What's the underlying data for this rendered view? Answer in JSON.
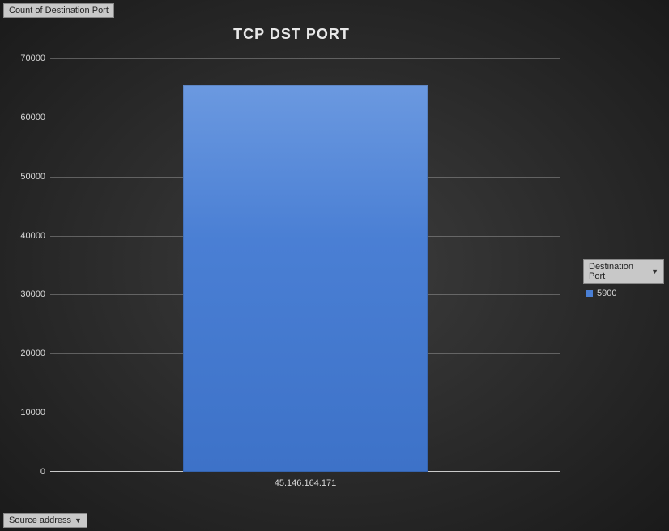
{
  "chart_data": {
    "type": "bar",
    "title": "TCP DST PORT",
    "categories": [
      "45.146.164.171"
    ],
    "series": [
      {
        "name": "5900",
        "values": [
          65500
        ]
      }
    ],
    "ylim": [
      0,
      70000
    ],
    "yticks": [
      0,
      10000,
      20000,
      30000,
      40000,
      50000,
      60000,
      70000
    ],
    "ylabel": "Count of Destination Port",
    "xlabel": "Source address"
  },
  "legend": {
    "header": "Destination Port"
  }
}
